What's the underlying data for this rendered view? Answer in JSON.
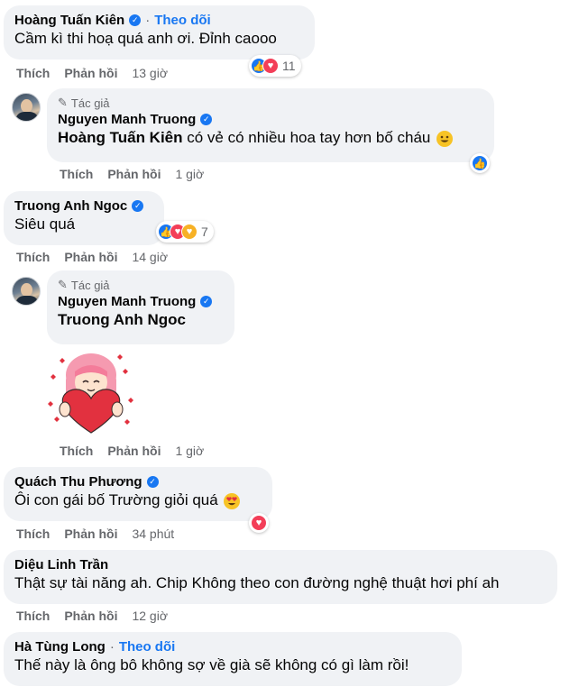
{
  "colors": {
    "bubble": "#f0f2f5",
    "link": "#1877f2",
    "muted": "#65676b",
    "love": "#f33e58"
  },
  "actions": {
    "like": "Thích",
    "reply": "Phản hồi"
  },
  "author_tag": "Tác giả",
  "comments": [
    {
      "name": "Hoàng Tuấn Kiên",
      "follow": "Theo dõi",
      "separator": "·",
      "text": "Cầm kì thi hoạ quá anh ơi. Đỉnh caooo",
      "reactions": [
        "like",
        "love"
      ],
      "reaction_count": "11",
      "time": "13 giờ"
    },
    {
      "name": "Nguyen Manh Truong",
      "mention": "Hoàng Tuấn Kiên",
      "text": " có vẻ có nhiều hoa tay hơn bố cháu",
      "emoji": "grinning-face",
      "reactions": [
        "like"
      ],
      "time": "1 giờ"
    },
    {
      "name": "Truong Anh Ngoc",
      "text": "Siêu quá",
      "reactions": [
        "like",
        "love",
        "care"
      ],
      "reaction_count": "7",
      "time": "14 giờ"
    },
    {
      "name": "Nguyen Manh Truong",
      "mention": "Truong Anh Ngoc",
      "sticker": "girl-hugging-heart-sticker",
      "time": "1 giờ"
    },
    {
      "name": "Quách Thu Phương",
      "text": "Ôi con gái bố Trường giỏi quá",
      "emoji": "heart-eyes-face",
      "reactions": [
        "love"
      ],
      "time": "34 phút"
    },
    {
      "name": "Diệu Linh Trần",
      "text": "Thật sự tài năng ah. Chip Không theo con đường nghệ thuật hơi phí ah",
      "time": "12 giờ"
    },
    {
      "name": "Hà Tùng Long",
      "follow": "Theo dõi",
      "separator": "·",
      "text": "Thế này là ông bô không sợ về già sẽ không có gì làm rồi!"
    }
  ]
}
